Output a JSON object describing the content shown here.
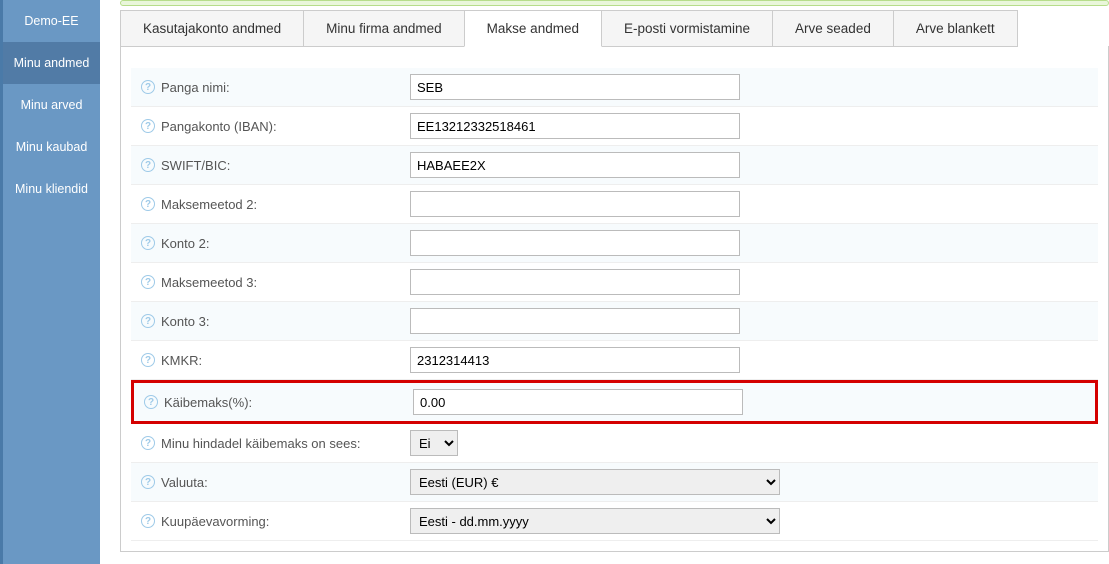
{
  "sidebar": {
    "items": [
      {
        "label": "Demo-EE"
      },
      {
        "label": "Minu andmed"
      },
      {
        "label": "Minu arved"
      },
      {
        "label": "Minu kaubad"
      },
      {
        "label": "Minu kliendid"
      }
    ]
  },
  "tabs": [
    {
      "label": "Kasutajakonto andmed"
    },
    {
      "label": "Minu firma andmed"
    },
    {
      "label": "Makse andmed"
    },
    {
      "label": "E-posti vormistamine"
    },
    {
      "label": "Arve seaded"
    },
    {
      "label": "Arve blankett"
    }
  ],
  "fields": {
    "bank_name": {
      "label": "Panga nimi:",
      "value": "SEB"
    },
    "iban": {
      "label": "Pangakonto (IBAN):",
      "value": "EE13212332518461"
    },
    "swift": {
      "label": "SWIFT/BIC:",
      "value": "HABAEE2X"
    },
    "method2": {
      "label": "Maksemeetod 2:",
      "value": ""
    },
    "account2": {
      "label": "Konto 2:",
      "value": ""
    },
    "method3": {
      "label": "Maksemeetod 3:",
      "value": ""
    },
    "account3": {
      "label": "Konto 3:",
      "value": ""
    },
    "kmkr": {
      "label": "KMKR:",
      "value": "2312314413"
    },
    "vat": {
      "label": "Käibemaks(%):",
      "value": "0.00"
    },
    "vat_incl": {
      "label": "Minu hindadel käibemaks on sees:",
      "value": "Ei"
    },
    "currency": {
      "label": "Valuuta:",
      "value": "Eesti (EUR) €"
    },
    "datefmt": {
      "label": "Kuupäevavorming:",
      "value": "Eesti - dd.mm.yyyy"
    }
  }
}
